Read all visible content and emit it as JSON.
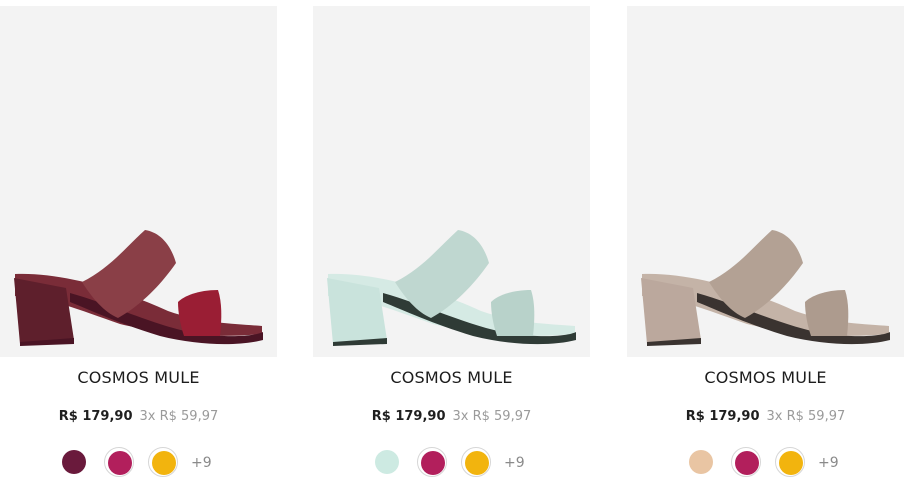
{
  "products": [
    {
      "name": "COSMOS MULE",
      "price": "R$ 179,90",
      "installment": "3x R$ 59,97",
      "image": {
        "name": "mule-sandal-icon",
        "sole": "#4a1424",
        "heel": "#5e1f2c",
        "wide_strap": "#8a3f47",
        "narrow_strap": "#9a1e34",
        "footbed": "#7a2c38"
      },
      "swatches": [
        {
          "name": "wine",
          "color": "#6a1a3c",
          "selected": false
        },
        {
          "name": "magenta",
          "color": "#b21f5c",
          "selected": true
        },
        {
          "name": "yellow",
          "color": "#f2b40e",
          "selected": true
        }
      ],
      "more_colors": "+9"
    },
    {
      "name": "COSMOS MULE",
      "price": "R$ 179,90",
      "installment": "3x R$ 59,97",
      "image": {
        "name": "mule-sandal-icon",
        "sole": "#2f3b36",
        "heel": "#c9e3dc",
        "wide_strap": "#bfd7d0",
        "narrow_strap": "#b8d2ca",
        "footbed": "#d5eae4"
      },
      "swatches": [
        {
          "name": "mint",
          "color": "#cdeae2",
          "selected": false
        },
        {
          "name": "magenta",
          "color": "#b21f5c",
          "selected": true
        },
        {
          "name": "yellow",
          "color": "#f2b40e",
          "selected": true
        }
      ],
      "more_colors": "+9"
    },
    {
      "name": "COSMOS MULE",
      "price": "R$ 179,90",
      "installment": "3x R$ 59,97",
      "image": {
        "name": "mule-sandal-icon",
        "sole": "#3a3330",
        "heel": "#bba89d",
        "wide_strap": "#b3a194",
        "narrow_strap": "#ad9b8e",
        "footbed": "#c4b3a7"
      },
      "swatches": [
        {
          "name": "nude",
          "color": "#e9c5a3",
          "selected": false
        },
        {
          "name": "magenta",
          "color": "#b21f5c",
          "selected": true
        },
        {
          "name": "yellow",
          "color": "#f2b40e",
          "selected": true
        }
      ],
      "more_colors": "+9"
    }
  ]
}
